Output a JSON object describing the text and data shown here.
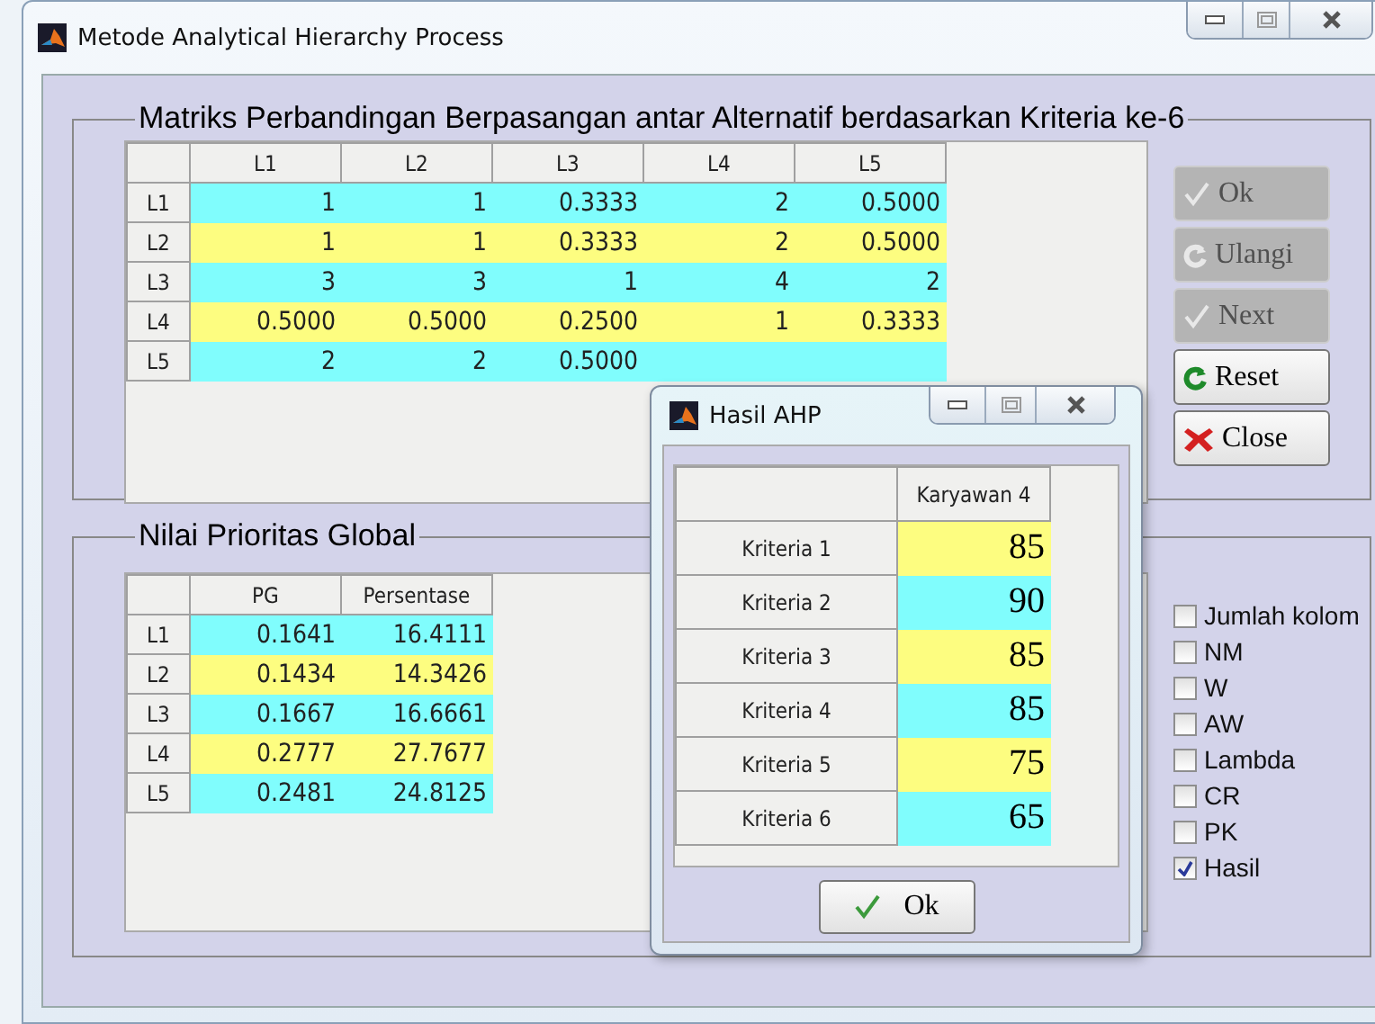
{
  "window": {
    "title": "Metode Analytical Hierarchy Process"
  },
  "matrix_panel": {
    "title": "Matriks Perbandingan Berpasangan antar Alternatif berdasarkan Kriteria ke-6",
    "table": {
      "columns": [
        "L1",
        "L2",
        "L3",
        "L4",
        "L5"
      ],
      "rows": [
        {
          "label": "L1",
          "cells": [
            "1",
            "1",
            "0.3333",
            "2",
            "0.5000"
          ]
        },
        {
          "label": "L2",
          "cells": [
            "1",
            "1",
            "0.3333",
            "2",
            "0.5000"
          ]
        },
        {
          "label": "L3",
          "cells": [
            "3",
            "3",
            "1",
            "4",
            "2"
          ]
        },
        {
          "label": "L4",
          "cells": [
            "0.5000",
            "0.5000",
            "0.2500",
            "1",
            "0.3333"
          ]
        },
        {
          "label": "L5",
          "cells": [
            "2",
            "2",
            "0.5000"
          ]
        }
      ]
    }
  },
  "buttons": [
    {
      "label": "Ok",
      "kind": "check",
      "disabled": true
    },
    {
      "label": "Ulangi",
      "kind": "refresh",
      "disabled": true
    },
    {
      "label": "Next",
      "kind": "check",
      "disabled": true
    },
    {
      "label": "Reset",
      "kind": "refresh",
      "disabled": false
    },
    {
      "label": "Close",
      "kind": "cross",
      "disabled": false
    }
  ],
  "priority_panel": {
    "title": "Nilai Prioritas Global",
    "table": {
      "columns": [
        "PG",
        "Persentase"
      ],
      "rows": [
        {
          "label": "L1",
          "cells": [
            "0.1641",
            "16.4111"
          ]
        },
        {
          "label": "L2",
          "cells": [
            "0.1434",
            "14.3426"
          ]
        },
        {
          "label": "L3",
          "cells": [
            "0.1667",
            "16.6661"
          ]
        },
        {
          "label": "L4",
          "cells": [
            "0.2777",
            "27.7677"
          ]
        },
        {
          "label": "L5",
          "cells": [
            "0.2481",
            "24.8125"
          ]
        }
      ]
    },
    "checkboxes": [
      {
        "label": "Jumlah kolom",
        "checked": false
      },
      {
        "label": "NM",
        "checked": false
      },
      {
        "label": "W",
        "checked": false
      },
      {
        "label": "AW",
        "checked": false
      },
      {
        "label": "Lambda",
        "checked": false
      },
      {
        "label": "CR",
        "checked": false
      },
      {
        "label": "PK",
        "checked": false
      },
      {
        "label": "Hasil",
        "checked": true
      }
    ]
  },
  "dialog": {
    "title": "Hasil AHP",
    "table": {
      "columns": [
        "Karyawan 4"
      ],
      "rows": [
        {
          "label": "Kriteria 1",
          "cells": [
            "85"
          ]
        },
        {
          "label": "Kriteria 2",
          "cells": [
            "90"
          ]
        },
        {
          "label": "Kriteria 3",
          "cells": [
            "85"
          ]
        },
        {
          "label": "Kriteria 4",
          "cells": [
            "85"
          ]
        },
        {
          "label": "Kriteria 5",
          "cells": [
            "75"
          ]
        },
        {
          "label": "Kriteria 6",
          "cells": [
            "65"
          ]
        }
      ]
    },
    "button": {
      "label": "Ok",
      "kind": "check"
    }
  }
}
